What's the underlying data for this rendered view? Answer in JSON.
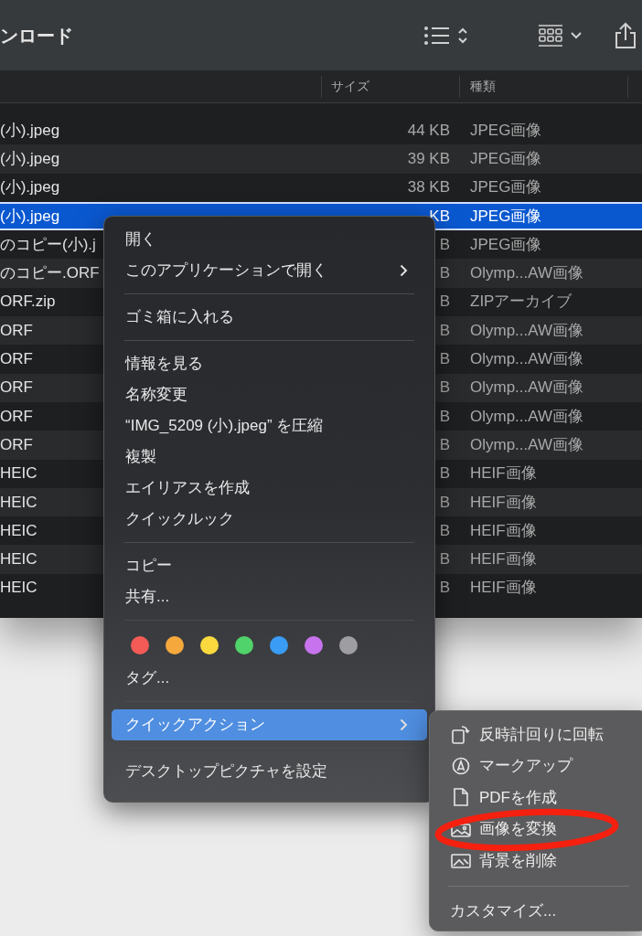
{
  "toolbar": {
    "title": "ンロード"
  },
  "columns": [
    {
      "label": "サイズ"
    },
    {
      "label": "種類"
    }
  ],
  "rows": [
    {
      "name": "(小).jpeg",
      "size": "44 KB",
      "kind": "JPEG画像",
      "selected": false
    },
    {
      "name": "(小).jpeg",
      "size": "39 KB",
      "kind": "JPEG画像",
      "selected": false
    },
    {
      "name": "(小).jpeg",
      "size": "38 KB",
      "kind": "JPEG画像",
      "selected": false
    },
    {
      "name": "(小).jpeg",
      "size": "KB",
      "kind": "JPEG画像",
      "selected": true
    },
    {
      "name": "のコピー(小).j",
      "size": "B",
      "kind": "JPEG画像",
      "selected": false
    },
    {
      "name": "のコピー.ORF",
      "size": "B",
      "kind": "Olymp...AW画像",
      "selected": false
    },
    {
      "name": "ORF.zip",
      "size": "B",
      "kind": "ZIPアーカイブ",
      "selected": false
    },
    {
      "name": "ORF",
      "size": "B",
      "kind": "Olymp...AW画像",
      "selected": false
    },
    {
      "name": "ORF",
      "size": "B",
      "kind": "Olymp...AW画像",
      "selected": false
    },
    {
      "name": "ORF",
      "size": "B",
      "kind": "Olymp...AW画像",
      "selected": false
    },
    {
      "name": "ORF",
      "size": "B",
      "kind": "Olymp...AW画像",
      "selected": false
    },
    {
      "name": "ORF",
      "size": "B",
      "kind": "Olymp...AW画像",
      "selected": false
    },
    {
      "name": "HEIC",
      "size": "B",
      "kind": "HEIF画像",
      "selected": false
    },
    {
      "name": "HEIC",
      "size": "B",
      "kind": "HEIF画像",
      "selected": false
    },
    {
      "name": "HEIC",
      "size": "B",
      "kind": "HEIF画像",
      "selected": false
    },
    {
      "name": "HEIC",
      "size": "B",
      "kind": "HEIF画像",
      "selected": false
    },
    {
      "name": "HEIC",
      "size": "B",
      "kind": "HEIF画像",
      "selected": false
    }
  ],
  "context_menu": {
    "items": [
      {
        "kind": "item",
        "label": "開く",
        "submenu": false,
        "selected": false
      },
      {
        "kind": "item",
        "label": "このアプリケーションで開く",
        "submenu": true,
        "selected": false
      },
      {
        "kind": "separator"
      },
      {
        "kind": "item",
        "label": "ゴミ箱に入れる",
        "submenu": false,
        "selected": false
      },
      {
        "kind": "separator"
      },
      {
        "kind": "item",
        "label": "情報を見る",
        "submenu": false,
        "selected": false
      },
      {
        "kind": "item",
        "label": "名称変更",
        "submenu": false,
        "selected": false
      },
      {
        "kind": "item",
        "label": "“IMG_5209 (小).jpeg” を圧縮",
        "submenu": false,
        "selected": false
      },
      {
        "kind": "item",
        "label": "複製",
        "submenu": false,
        "selected": false
      },
      {
        "kind": "item",
        "label": "エイリアスを作成",
        "submenu": false,
        "selected": false
      },
      {
        "kind": "item",
        "label": "クイックルック",
        "submenu": false,
        "selected": false
      },
      {
        "kind": "separator"
      },
      {
        "kind": "item",
        "label": "コピー",
        "submenu": false,
        "selected": false
      },
      {
        "kind": "item",
        "label": "共有...",
        "submenu": false,
        "selected": false
      },
      {
        "kind": "separator"
      },
      {
        "kind": "tags",
        "colors": [
          {
            "color": "#f45b57"
          },
          {
            "color": "#f5a93d"
          },
          {
            "color": "#fad93f"
          },
          {
            "color": "#50d36a"
          },
          {
            "color": "#3a9cf4"
          },
          {
            "color": "#c873ee"
          },
          {
            "color": "#9e9ea2"
          }
        ]
      },
      {
        "kind": "item",
        "label": "タグ...",
        "submenu": false,
        "selected": false
      },
      {
        "kind": "separator"
      },
      {
        "kind": "item",
        "label": "クイックアクション",
        "submenu": true,
        "selected": true
      },
      {
        "kind": "separator"
      },
      {
        "kind": "item",
        "label": "デスクトップピクチャを設定",
        "submenu": false,
        "selected": false
      }
    ]
  },
  "submenu": {
    "items": [
      {
        "kind": "item",
        "label": "反時計回りに回転"
      },
      {
        "kind": "item",
        "label": "マークアップ"
      },
      {
        "kind": "item",
        "label": "PDFを作成"
      },
      {
        "kind": "item",
        "label": "画像を変換"
      },
      {
        "kind": "item",
        "label": "背景を削除"
      },
      {
        "kind": "separator"
      },
      {
        "kind": "item",
        "label": "カスタマイズ..."
      }
    ]
  }
}
